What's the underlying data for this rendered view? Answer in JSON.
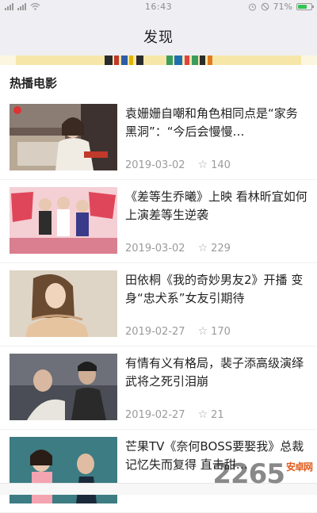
{
  "status_bar": {
    "time": "16:43",
    "battery": "71%",
    "battery_level": 0.71
  },
  "header": {
    "title": "发现"
  },
  "section": {
    "title": "热播电影"
  },
  "articles": [
    {
      "title": "袁姗姗自嘲和角色相同点是“家务黑洞”：“今后会慢慢…",
      "date": "2019-03-02",
      "stars": "140"
    },
    {
      "title": "《差等生乔曦》上映 看林昕宜如何上演差等生逆袭",
      "date": "2019-03-02",
      "stars": "229"
    },
    {
      "title": "田依桐《我的奇妙男友2》开播 变身“忠犬系”女友引期待",
      "date": "2019-02-27",
      "stars": "170"
    },
    {
      "title": "有情有义有格局，裴子添高级演绎武将之死引泪崩",
      "date": "2019-02-27",
      "stars": "21"
    },
    {
      "title": "芒果TV《奈何BOSS要娶我》总裁记忆失而复得 直击甜…",
      "date": "",
      "stars": ""
    }
  ],
  "watermark": {
    "main": "2265",
    "sub": "安卓网"
  },
  "colors": {
    "header_bg": "#efeef2",
    "text": "#222222",
    "meta": "#9b9b9b",
    "battery": "#33c453"
  }
}
